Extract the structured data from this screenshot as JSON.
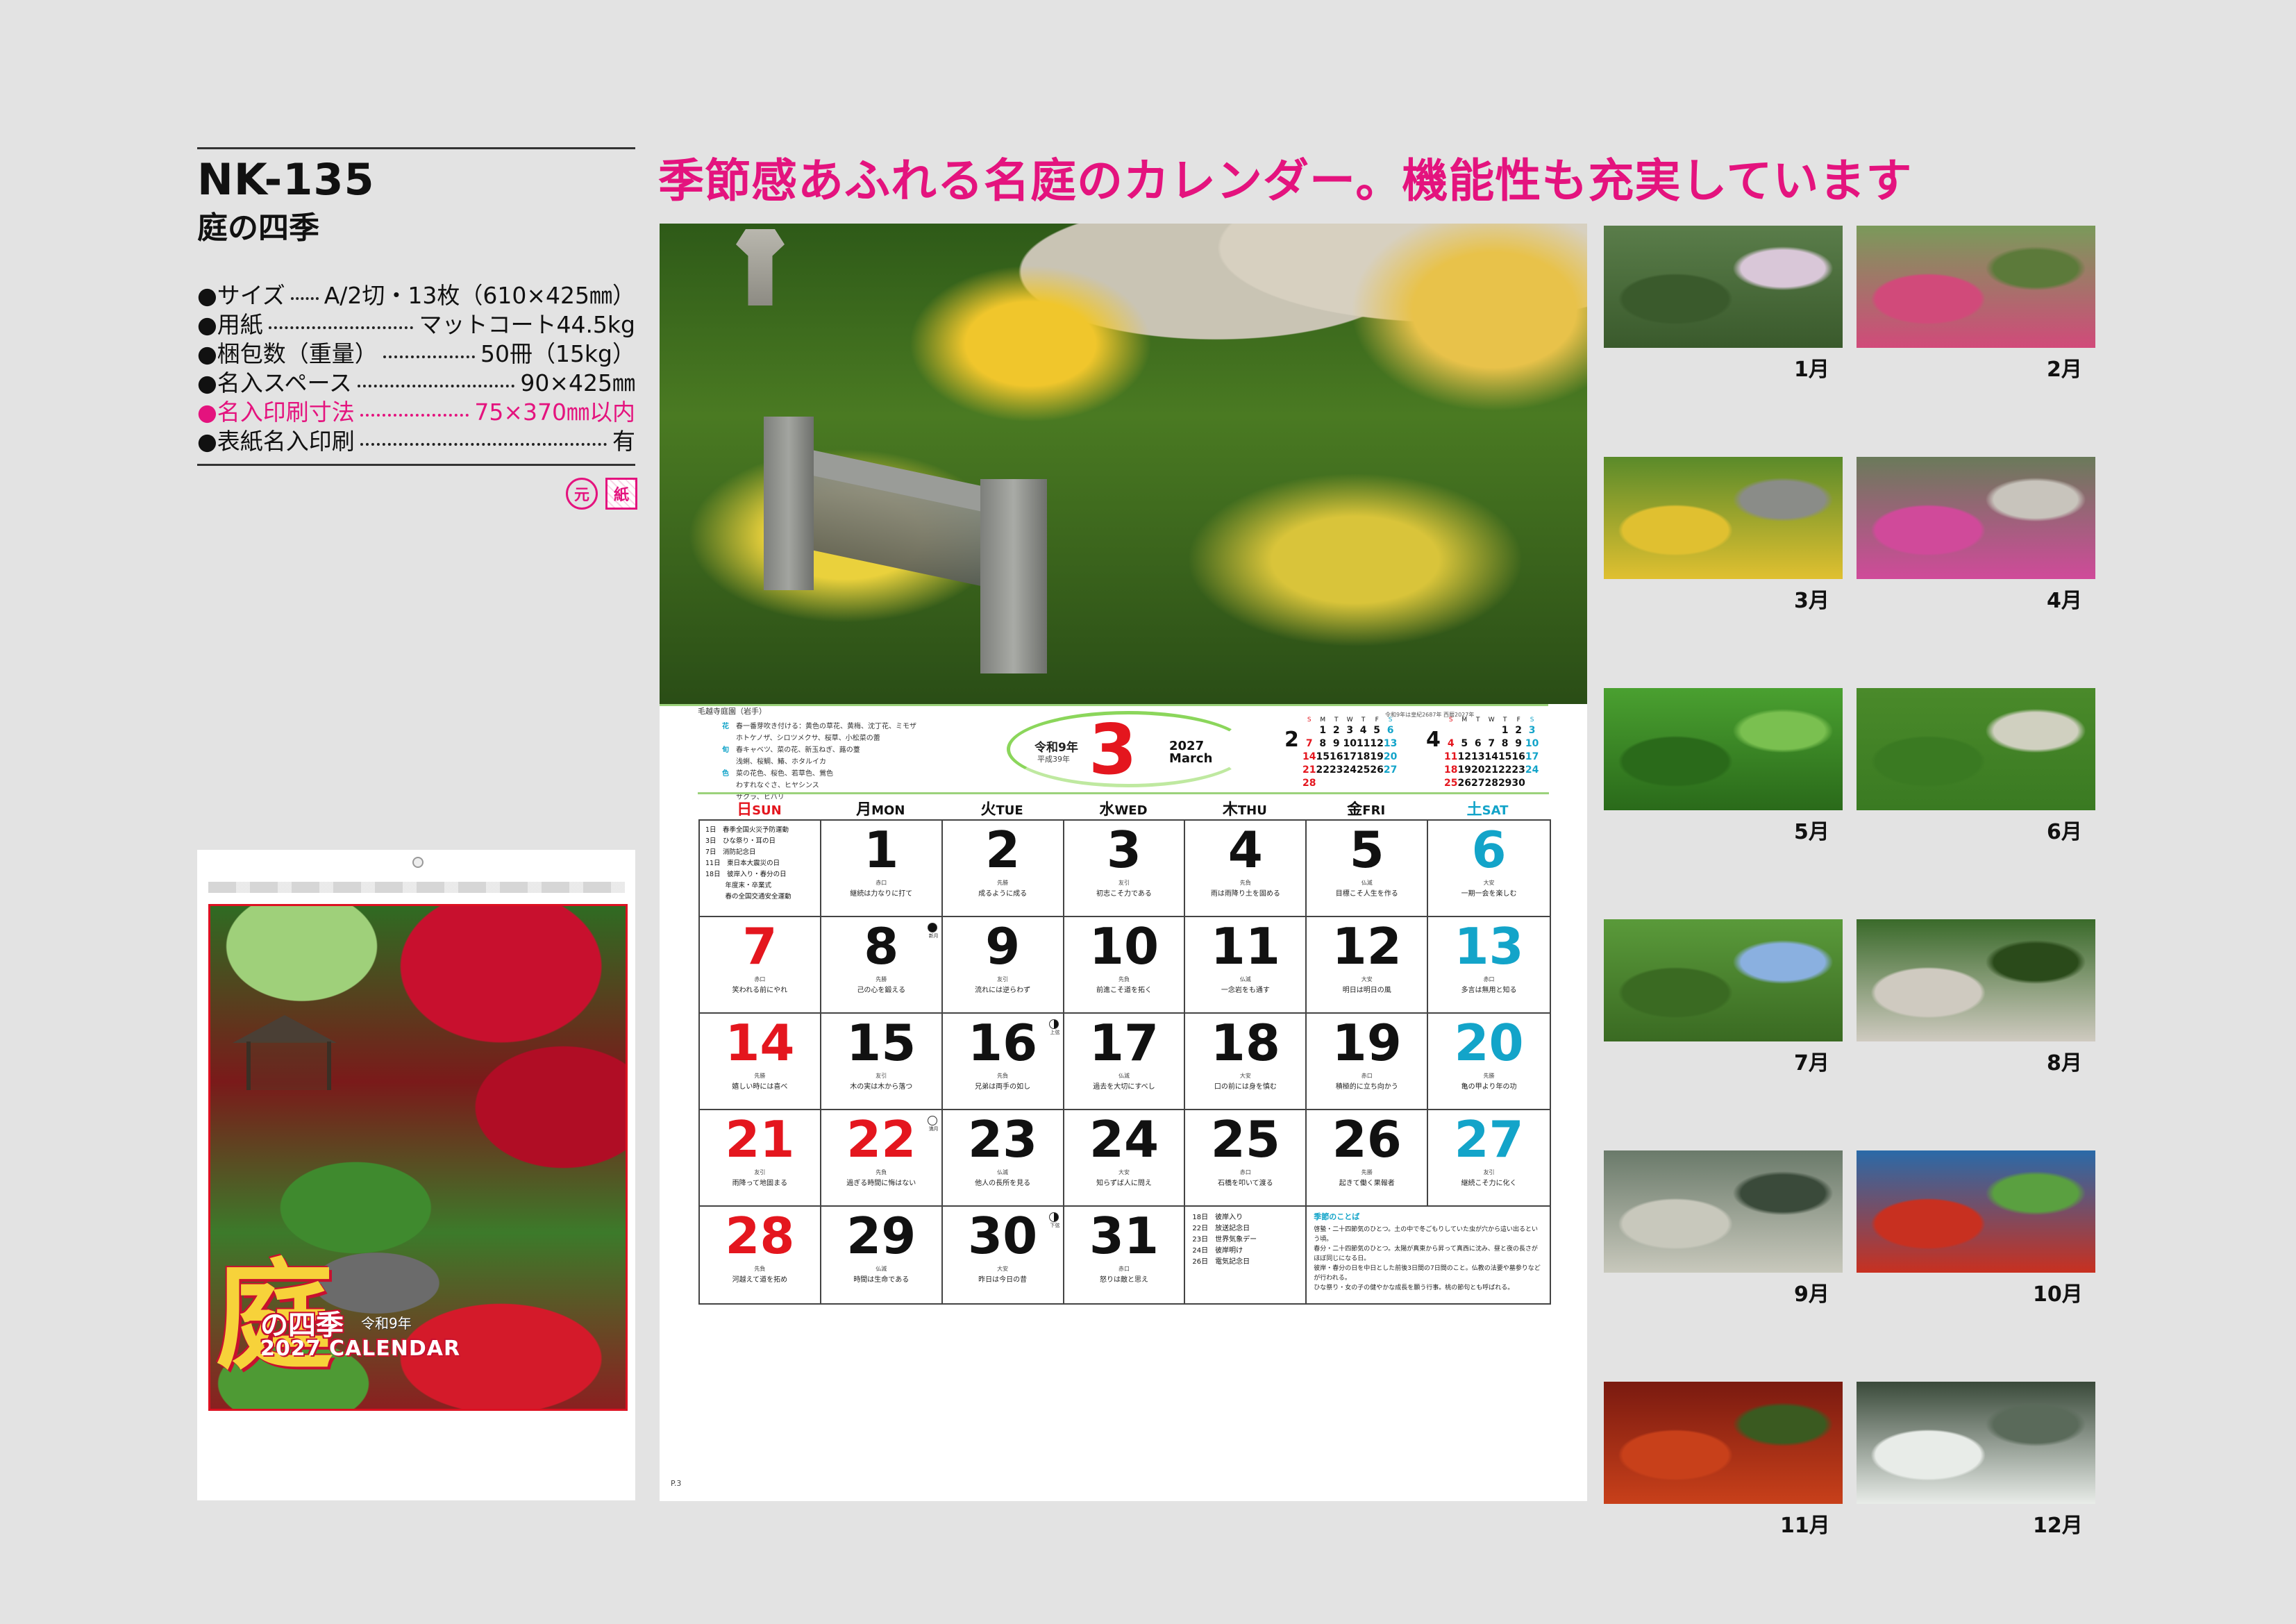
{
  "product": {
    "code": "NK-135",
    "name": "庭の四季",
    "specs": [
      {
        "label": "●サイズ",
        "value": "A/2切・13枚（610×425㎜）",
        "pink": false
      },
      {
        "label": "●用紙",
        "value": "マットコート44.5kg",
        "pink": false
      },
      {
        "label": "●梱包数（重量）",
        "value": "50冊（15kg）",
        "pink": false
      },
      {
        "label": "●名入スペース",
        "value": "90×425㎜",
        "pink": false
      },
      {
        "label": "●名入印刷寸法",
        "value": "75×370㎜以内",
        "pink": true
      },
      {
        "label": "●表紙名入印刷",
        "value": "有",
        "pink": false
      }
    ],
    "badges": {
      "gen": "元",
      "kami": "紙"
    }
  },
  "headline": "季節感あふれる名庭のカレンダー。機能性も充実しています",
  "cover": {
    "kanji": "庭",
    "title": "の四季",
    "subtitle": "令和9年",
    "year_label": "2027 CALENDAR"
  },
  "calendar": {
    "photo_caption": "毛越寺庭園（岩手）",
    "era": "令和9年",
    "era_small": "平成39年",
    "month": "3",
    "year_en": "2027",
    "month_en": "March",
    "mini_note": "令和9年は皇紀2687年 西暦2027年",
    "notes": [
      {
        "cat": "花",
        "text": "春一番芽吹き付ける：黄色の草花、黄梅、沈丁花、ミモザ"
      },
      {
        "cat": "",
        "text": "ホトケノザ、シロツメクサ、桜草、小松菜の蕾"
      },
      {
        "cat": "旬",
        "text": "春キャベツ、菜の花、新玉ねぎ、蕗の薹"
      },
      {
        "cat": "",
        "text": "浅蜊、桜鯛、鰆、ホタルイカ"
      },
      {
        "cat": "色",
        "text": "菜の花色、桜色、若草色、鶯色"
      },
      {
        "cat": "",
        "text": "わすれなぐさ、ヒヤシンス"
      },
      {
        "cat": "",
        "text": "サクラ、ヒバリ"
      }
    ],
    "mini_months": [
      {
        "num": "2",
        "weekdays": [
          "S",
          "M",
          "T",
          "W",
          "T",
          "F",
          "S"
        ],
        "weeks": [
          [
            "",
            "1",
            "2",
            "3",
            "4",
            "5",
            "6"
          ],
          [
            "7",
            "8",
            "9",
            "10",
            "11",
            "12",
            "13"
          ],
          [
            "14",
            "15",
            "16",
            "17",
            "18",
            "19",
            "20"
          ],
          [
            "21",
            "22",
            "23",
            "24",
            "25",
            "26",
            "27"
          ],
          [
            "28",
            "",
            "",
            "",
            "",
            "",
            ""
          ]
        ]
      },
      {
        "num": "4",
        "weekdays": [
          "S",
          "M",
          "T",
          "W",
          "T",
          "F",
          "S"
        ],
        "weeks": [
          [
            "",
            "",
            "",
            "",
            "1",
            "2",
            "3"
          ],
          [
            "4",
            "5",
            "6",
            "7",
            "8",
            "9",
            "10"
          ],
          [
            "11",
            "12",
            "13",
            "14",
            "15",
            "16",
            "17"
          ],
          [
            "18",
            "19",
            "20",
            "21",
            "22",
            "23",
            "24"
          ],
          [
            "25",
            "26",
            "27",
            "28",
            "29",
            "30",
            ""
          ]
        ]
      }
    ],
    "weekdays": [
      {
        "jp": "日",
        "en": "SUN",
        "color": "#e4161e"
      },
      {
        "jp": "月",
        "en": "MON",
        "color": "#111111"
      },
      {
        "jp": "火",
        "en": "TUE",
        "color": "#111111"
      },
      {
        "jp": "水",
        "en": "WED",
        "color": "#111111"
      },
      {
        "jp": "木",
        "en": "THU",
        "color": "#111111"
      },
      {
        "jp": "金",
        "en": "FRI",
        "color": "#111111"
      },
      {
        "jp": "土",
        "en": "SAT",
        "color": "#13a4c9"
      }
    ],
    "holidays_list": [
      "1日　春季全国火災予防運動",
      "3日　ひな祭り・耳の日",
      "7日　消防記念日",
      "11日　東日本大震災の日",
      "18日　彼岸入り・春分の日",
      "　　　年度末・卒業式",
      "　　　春の全国交通安全運動"
    ],
    "days": [
      {
        "d": "",
        "row": 0,
        "col": 0,
        "type": "list"
      },
      {
        "d": "1",
        "row": 0,
        "col": 1,
        "six": "赤口",
        "say": "継続は力なりに打て"
      },
      {
        "d": "2",
        "row": 0,
        "col": 2,
        "six": "先勝",
        "say": "成るように成る"
      },
      {
        "d": "3",
        "row": 0,
        "col": 3,
        "six": "友引",
        "say": "初志こそ力である"
      },
      {
        "d": "4",
        "row": 0,
        "col": 4,
        "six": "先負",
        "say": "雨は雨降り土を固める"
      },
      {
        "d": "5",
        "row": 0,
        "col": 5,
        "six": "仏滅",
        "say": "目標こそ人生を作る"
      },
      {
        "d": "6",
        "row": 0,
        "col": 6,
        "six": "大安",
        "say": "一期一会を楽しむ",
        "c": "sat"
      },
      {
        "d": "7",
        "row": 1,
        "col": 0,
        "six": "赤口",
        "say": "笑われる前にやれ",
        "c": "sun"
      },
      {
        "d": "8",
        "row": 1,
        "col": 1,
        "six": "先勝",
        "say": "己の心を鍛える",
        "moon": "new",
        "moonlbl": "新月"
      },
      {
        "d": "9",
        "row": 1,
        "col": 2,
        "six": "友引",
        "say": "流れには逆らわず"
      },
      {
        "d": "10",
        "row": 1,
        "col": 3,
        "six": "先負",
        "say": "前進こそ道を拓く"
      },
      {
        "d": "11",
        "row": 1,
        "col": 4,
        "six": "仏滅",
        "say": "一念岩をも通す"
      },
      {
        "d": "12",
        "row": 1,
        "col": 5,
        "six": "大安",
        "say": "明日は明日の風"
      },
      {
        "d": "13",
        "row": 1,
        "col": 6,
        "six": "赤口",
        "say": "多言は無用と知る",
        "c": "sat"
      },
      {
        "d": "14",
        "row": 2,
        "col": 0,
        "six": "先勝",
        "say": "嬉しい時には喜べ",
        "c": "sun"
      },
      {
        "d": "15",
        "row": 2,
        "col": 1,
        "six": "友引",
        "say": "木の実は木から落つ"
      },
      {
        "d": "16",
        "row": 2,
        "col": 2,
        "six": "先負",
        "say": "兄弟は両手の如し",
        "moon": "half",
        "moonlbl": "上弦"
      },
      {
        "d": "17",
        "row": 2,
        "col": 3,
        "six": "仏滅",
        "say": "過去を大切にすべし"
      },
      {
        "d": "18",
        "row": 2,
        "col": 4,
        "six": "大安",
        "say": "口の前には身を慎む"
      },
      {
        "d": "19",
        "row": 2,
        "col": 5,
        "six": "赤口",
        "say": "積極的に立ち向かう"
      },
      {
        "d": "20",
        "row": 2,
        "col": 6,
        "six": "先勝",
        "say": "亀の甲より年の功",
        "c": "sat"
      },
      {
        "d": "21",
        "row": 3,
        "col": 0,
        "six": "友引",
        "say": "雨降って地固まる",
        "c": "sun"
      },
      {
        "d": "22",
        "row": 3,
        "col": 1,
        "six": "先負",
        "say": "過ぎる時間に悔はない",
        "c": "sun",
        "moon": "full",
        "moonlbl": "満月"
      },
      {
        "d": "23",
        "row": 3,
        "col": 2,
        "six": "仏滅",
        "say": "他人の長所を見る"
      },
      {
        "d": "24",
        "row": 3,
        "col": 3,
        "six": "大安",
        "say": "知らずば人に問え"
      },
      {
        "d": "25",
        "row": 3,
        "col": 4,
        "six": "赤口",
        "say": "石橋を叩いて渡る"
      },
      {
        "d": "26",
        "row": 3,
        "col": 5,
        "six": "先勝",
        "say": "起きて働く果報者"
      },
      {
        "d": "27",
        "row": 3,
        "col": 6,
        "six": "友引",
        "say": "継続こそ力に化く",
        "c": "sat"
      },
      {
        "d": "28",
        "row": 4,
        "col": 0,
        "six": "先負",
        "say": "河越えて道を拓め",
        "c": "sun"
      },
      {
        "d": "29",
        "row": 4,
        "col": 1,
        "six": "仏滅",
        "say": "時間は生命である"
      },
      {
        "d": "30",
        "row": 4,
        "col": 2,
        "six": "大安",
        "say": "昨日は今日の昔",
        "moon": "half",
        "moonlbl": "下弦"
      },
      {
        "d": "31",
        "row": 4,
        "col": 3,
        "six": "赤口",
        "say": "怒りは敵と思え"
      }
    ],
    "events": [
      "18日　彼岸入り",
      "22日　放送記念日",
      "23日　世界気象デー",
      "24日　彼岸明け",
      "26日　電気記念日"
    ],
    "season_title": "季節のことば",
    "season_text": [
      "啓蟄・二十四節気のひとつ。土の中で冬ごもりしていた虫が穴から這い出るという頃。",
      "春分・二十四節気のひとつ。太陽が真東から昇って真西に沈み、昼と夜の長さがほぼ同じになる日。",
      "彼岸・春分の日を中日とした前後3日間の7日間のこと。仏教の法要や墓参りなどが行われる。",
      "ひな祭り・女の子の健やかな成長を願う行事。桃の節句とも呼ばれる。"
    ],
    "page_number": "P.3"
  },
  "thumbs": [
    {
      "label": "1月",
      "c1": "#5a7d4a",
      "c2": "#3a5a2c",
      "c3": "#d9c7d8"
    },
    {
      "label": "2月",
      "c1": "#7a9a5a",
      "c2": "#d14a7a",
      "c3": "#5c7a3a"
    },
    {
      "label": "3月",
      "c1": "#5a8a2a",
      "c2": "#e0c030",
      "c3": "#8a8c88"
    },
    {
      "label": "4月",
      "c1": "#6a7a5a",
      "c2": "#d04a9a",
      "c3": "#c8c4bc"
    },
    {
      "label": "5月",
      "c1": "#4aa030",
      "c2": "#2a6a1a",
      "c3": "#7ac050"
    },
    {
      "label": "6月",
      "c1": "#4a8a2a",
      "c2": "#3a7a22",
      "c3": "#d0d0c0"
    },
    {
      "label": "7月",
      "c1": "#5a9a3a",
      "c2": "#3a6a22",
      "c3": "#8ab0e0"
    },
    {
      "label": "8月",
      "c1": "#3a6a2a",
      "c2": "#cfcac0",
      "c3": "#2a4a1a"
    },
    {
      "label": "9月",
      "c1": "#6a7a6a",
      "c2": "#c8c8bc",
      "c3": "#3a4a3a"
    },
    {
      "label": "10月",
      "c1": "#2a6aa8",
      "c2": "#c83020",
      "c3": "#5aa040"
    },
    {
      "label": "11月",
      "c1": "#7a1a10",
      "c2": "#c8401a",
      "c3": "#3a5a20"
    },
    {
      "label": "12月",
      "c1": "#3a4a3a",
      "c2": "#e8ece8",
      "c3": "#5a6a5a"
    }
  ]
}
